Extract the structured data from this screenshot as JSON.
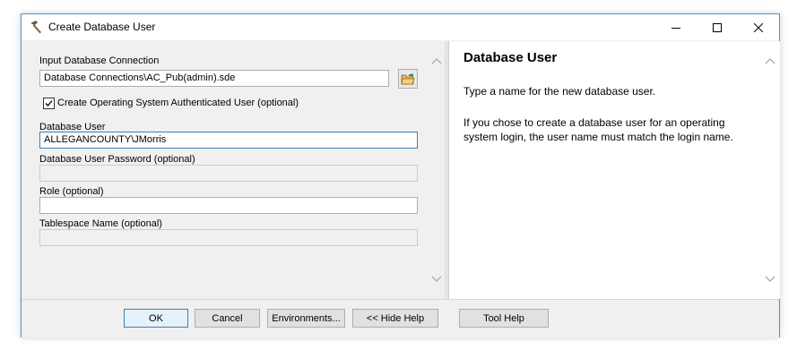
{
  "window": {
    "title": "Create Database User"
  },
  "form": {
    "input_connection_label": "Input Database Connection",
    "input_connection_value": "Database Connections\\AC_Pub(admin).sde",
    "os_auth_label": "Create Operating System Authenticated User (optional)",
    "os_auth_checked": true,
    "db_user_label": "Database User",
    "db_user_value": "ALLEGANCOUNTY\\JMorris",
    "password_label": "Database User Password (optional)",
    "password_value": "",
    "role_label": "Role (optional)",
    "role_value": "",
    "tablespace_label": "Tablespace Name (optional)",
    "tablespace_value": ""
  },
  "help": {
    "title": "Database User",
    "para1": "Type a name for the new database user.",
    "para2": "If you chose to create a database user for an operating system login, the user name must match the login name."
  },
  "buttons": {
    "ok": "OK",
    "cancel": "Cancel",
    "environments": "Environments...",
    "hide_help": "<< Hide Help",
    "tool_help": "Tool Help"
  },
  "colors": {
    "accent": "#3c7fb1",
    "window_border": "#5a8fc8",
    "folder_icon": "#e8b44a"
  }
}
